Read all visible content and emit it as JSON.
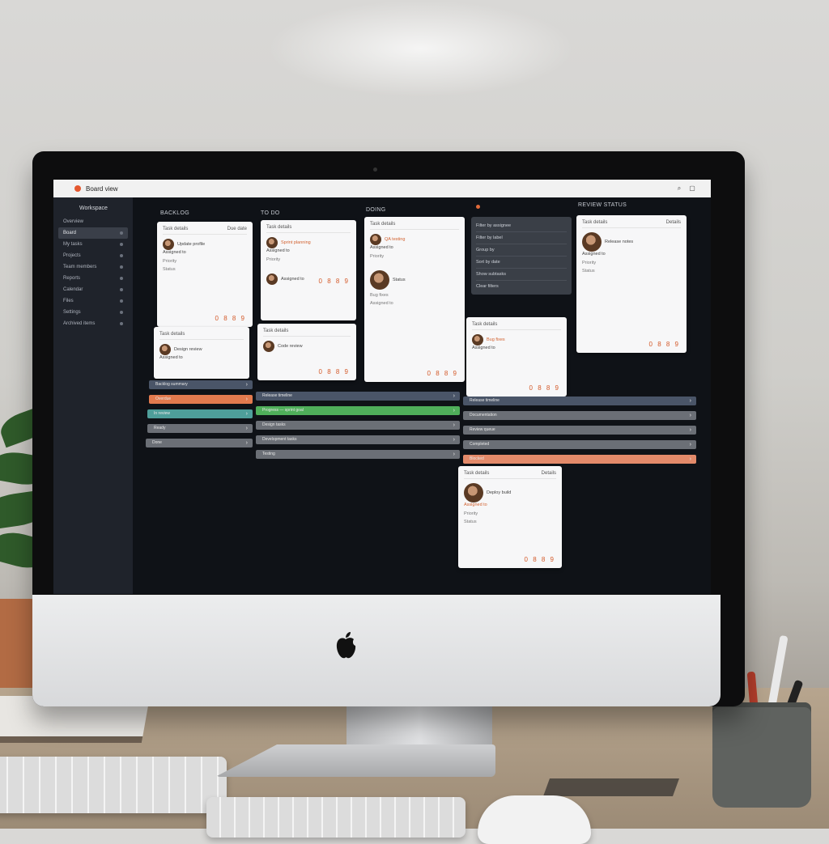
{
  "app": {
    "title": "Board view",
    "window_controls": [
      "⌕",
      "▢"
    ]
  },
  "sidebar": {
    "header": "Workspace",
    "items": [
      {
        "label": "Overview"
      },
      {
        "label": "Board",
        "active": true
      },
      {
        "label": "My tasks"
      },
      {
        "label": "Projects"
      },
      {
        "label": "Team members"
      },
      {
        "label": "Reports"
      },
      {
        "label": "Calendar"
      },
      {
        "label": "Files"
      },
      {
        "label": "Settings"
      },
      {
        "label": "Archived items"
      }
    ]
  },
  "columns": [
    {
      "title": "BACKLOG"
    },
    {
      "title": "TO DO"
    },
    {
      "title": "DOING"
    },
    {
      "title": ""
    },
    {
      "title": "REVIEW STATUS"
    }
  ],
  "cards": [
    {
      "head_left": "Task details",
      "head_right": "Due date",
      "line1": "Update profile",
      "line2": "Assigned to",
      "meta1": "Priority",
      "meta2": "Status",
      "foot": "0 8 8 9",
      "orange": false
    },
    {
      "head_left": "Task details",
      "head_right": "",
      "line1": "Design review",
      "line2": "Assigned to",
      "meta1": "",
      "meta2": "",
      "foot": "",
      "orange": false
    },
    {
      "head_left": "Task details",
      "head_right": "",
      "line1": "Sprint planning",
      "line2": "Assigned to",
      "meta1": "Priority",
      "meta2": "",
      "foot": "0 8 8 9",
      "orange": true
    },
    {
      "head_left": "Task details",
      "head_right": "",
      "line1": "Code review",
      "line2": "Assigned to",
      "meta1": "",
      "meta2": "",
      "foot": "0 8 8 9",
      "orange": false
    },
    {
      "head_left": "Task details",
      "head_right": "",
      "line1": "QA testing",
      "line2": "Assigned to",
      "meta1": "Priority",
      "meta2": "Status",
      "foot": "0 8 8 9",
      "orange": true
    },
    {
      "head_left": "Task details",
      "head_right": "",
      "line1": "Bug fixes",
      "line2": "Assigned to",
      "meta1": "",
      "meta2": "",
      "foot": "0 8 8 9",
      "orange": true
    },
    {
      "head_left": "Task details",
      "head_right": "Details",
      "line1": "Release notes",
      "line2": "Assigned to",
      "meta1": "Priority",
      "meta2": "Status",
      "foot": "0 8 8 9",
      "orange": false
    },
    {
      "head_left": "Task details",
      "head_right": "Details",
      "line1": "Deploy build",
      "line2": "Assigned to",
      "meta1": "Priority",
      "meta2": "Status",
      "foot": "0 8 8 9",
      "orange": true
    }
  ],
  "dark_list": [
    {
      "label": "Filter by assignee"
    },
    {
      "label": "Filter by label"
    },
    {
      "label": "Group by"
    },
    {
      "label": "Sort by date"
    },
    {
      "label": "Show subtasks"
    },
    {
      "label": "Clear filters"
    }
  ],
  "bars": [
    {
      "label": "Backlog summary",
      "color": "slate"
    },
    {
      "label": "Overdue",
      "color": "orange"
    },
    {
      "label": "In review",
      "color": "teal"
    },
    {
      "label": "Ready",
      "color": "grey"
    },
    {
      "label": "Done",
      "color": "grey"
    },
    {
      "label": "Progress — sprint goal",
      "color": "green"
    },
    {
      "label": "Design tasks",
      "color": "grey"
    },
    {
      "label": "Development tasks",
      "color": "grey"
    },
    {
      "label": "Testing",
      "color": "grey"
    },
    {
      "label": "Release timeline",
      "color": "slate"
    },
    {
      "label": "Documentation",
      "color": "grey"
    },
    {
      "label": "Review queue",
      "color": "grey"
    },
    {
      "label": "Completed",
      "color": "grey"
    },
    {
      "label": "Blocked",
      "color": "salmon"
    }
  ],
  "colors": {
    "accent": "#e4572e",
    "screen_bg": "#0f1217",
    "sidebar_bg": "#1f232b",
    "green": "#4fae5a",
    "orange": "#e27a4e",
    "slate": "#4a5568"
  }
}
